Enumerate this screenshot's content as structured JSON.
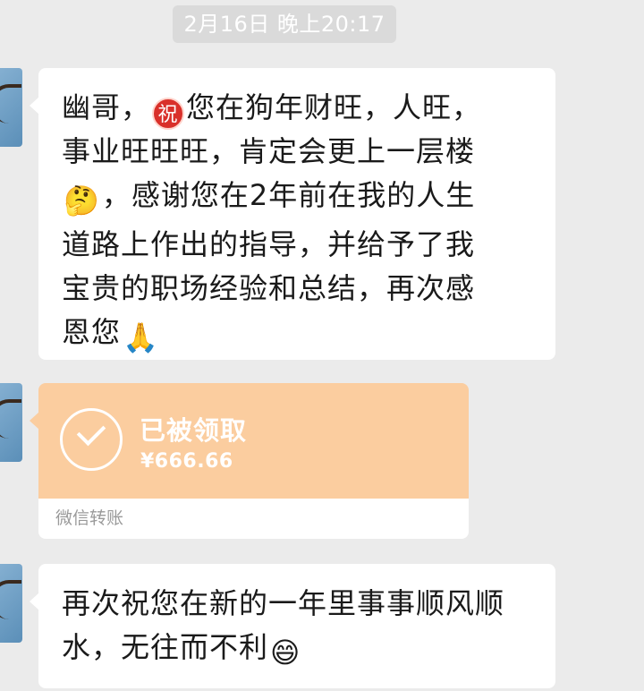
{
  "timestamp": "2月16日 晚上20:17",
  "messages": {
    "first": {
      "line1_a": "幽哥，",
      "zhu_badge": "祝",
      "line1_b": "您在狗年财旺，人旺，",
      "line2": "事业旺旺旺，肯定会更上一层楼",
      "thinking_emoji": "🤔",
      "line3": "，感谢您在2年前在我的人生",
      "line4": "道路上作出的指导，并给予了我",
      "line5": "宝贵的职场经验和总结，再次感",
      "line6": "恩您",
      "pray_emoji": "🙏"
    },
    "transfer": {
      "status": "已被领取",
      "amount": "¥666.66",
      "footer": "微信转账"
    },
    "second": {
      "line1": "再次祝您在新的一年里事事顺风顺",
      "line2": "水，无往而不利",
      "smile_emoji": "😄"
    }
  },
  "colors": {
    "background": "#ebebeb",
    "bubble": "#ffffff",
    "transfer_accent": "#fbcd9f",
    "timestamp_bg": "#dadada"
  }
}
